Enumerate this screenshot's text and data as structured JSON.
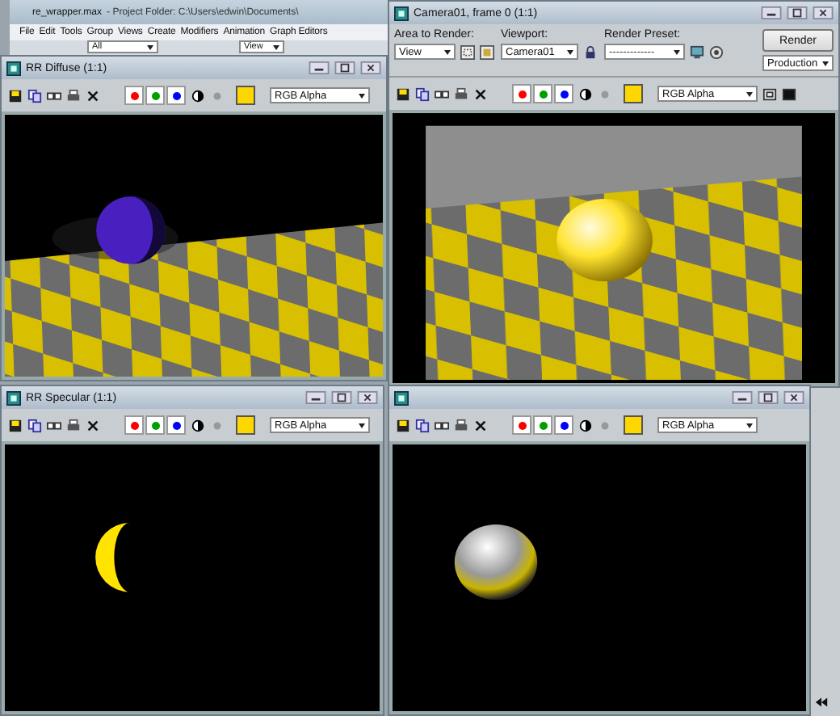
{
  "main_window": {
    "title": "re_wrapper.max",
    "subtitle": "- Project Folder: C:\\Users\\edwin\\Documents\\",
    "menu": [
      "File",
      "Edit",
      "Tools",
      "Group",
      "Views",
      "Create",
      "Modifiers",
      "Animation",
      "Graph Editors"
    ],
    "selection_filter": "All",
    "reference_coord": "View"
  },
  "render_windows": [
    {
      "title": "RR Diffuse (1:1)",
      "kind": "diffuse",
      "channel_display": "RGB Alpha",
      "channels": [
        {
          "color": "#ff0000",
          "on": true
        },
        {
          "color": "#00a000",
          "on": true
        },
        {
          "color": "#0000ff",
          "on": true
        }
      ]
    },
    {
      "title": "Camera01, frame 0 (1:1)",
      "kind": "beauty",
      "channel_display": "RGB Alpha",
      "channels": [
        {
          "color": "#ff0000",
          "on": true
        },
        {
          "color": "#00a000",
          "on": true
        },
        {
          "color": "#0000ff",
          "on": true
        }
      ],
      "render_setup": {
        "area_label": "Area to Render:",
        "area": "View",
        "viewport_label": "Viewport:",
        "viewport": "Camera01",
        "preset_label": "Render Preset:",
        "preset": "-------------",
        "render_button": "Render",
        "mode": "Production"
      }
    },
    {
      "title": "RR Specular (1:1)",
      "kind": "specular",
      "channel_display": "RGB Alpha",
      "channels": [
        {
          "color": "#ff0000",
          "on": true
        },
        {
          "color": "#00a000",
          "on": true
        },
        {
          "color": "#0000ff",
          "on": true
        }
      ]
    },
    {
      "kind": "reflection",
      "channel_display": "RGB Alpha",
      "channels": [
        {
          "color": "#ff0000",
          "on": true
        },
        {
          "color": "#00a000",
          "on": true
        },
        {
          "color": "#0000ff",
          "on": true
        }
      ]
    }
  ]
}
